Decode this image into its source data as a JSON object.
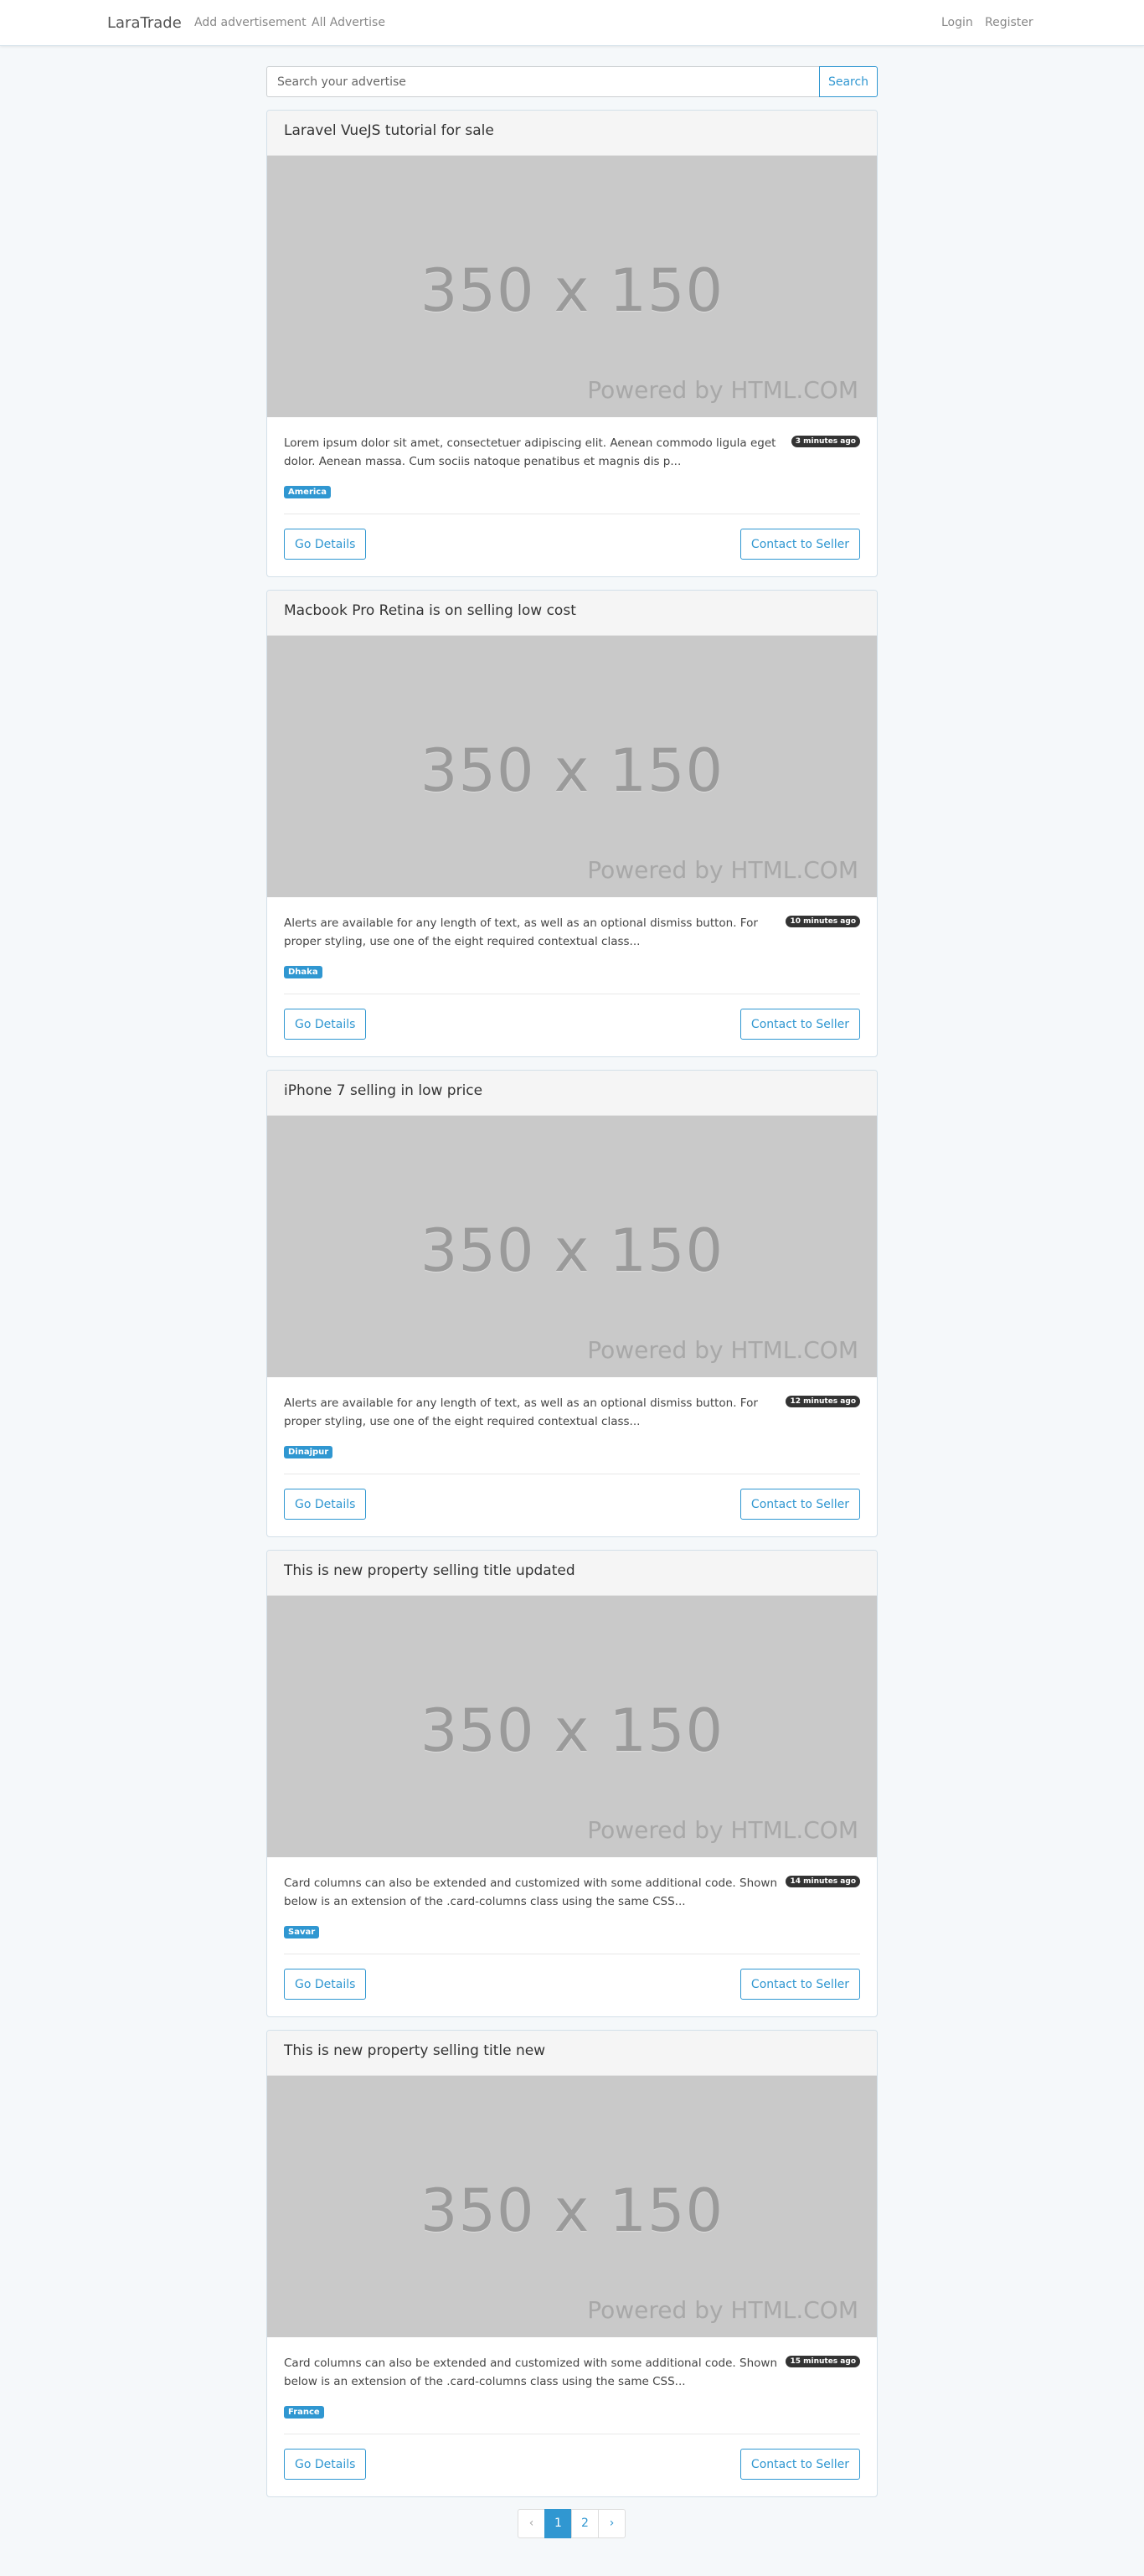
{
  "navbar": {
    "brand": "LaraTrade",
    "links": [
      "Add advertisement",
      "All Advertise"
    ],
    "auth": [
      "Login",
      "Register"
    ]
  },
  "search": {
    "placeholder": "Search your advertise",
    "button": "Search"
  },
  "placeholder_image": {
    "main_text": "350 x 150",
    "powered_text": "Powered by HTML.COM"
  },
  "ads": [
    {
      "title": "Laravel VueJS tutorial for sale",
      "excerpt": "Lorem ipsum dolor sit amet, consectetuer adipiscing elit. Aenean commodo ligula eget dolor. Aenean massa. Cum sociis natoque penatibus et magnis dis p...",
      "time": "3 minutes ago",
      "location": "America",
      "details_label": "Go Details",
      "contact_label": "Contact to Seller"
    },
    {
      "title": "Macbook Pro Retina is on selling low cost",
      "excerpt": "Alerts are available for any length of text, as well as an optional dismiss button. For proper styling, use one of the eight required contextual class...",
      "time": "10 minutes ago",
      "location": "Dhaka",
      "details_label": "Go Details",
      "contact_label": "Contact to Seller"
    },
    {
      "title": "iPhone 7 selling in low price",
      "excerpt": "Alerts are available for any length of text, as well as an optional dismiss button. For proper styling, use one of the eight required contextual class...",
      "time": "12 minutes ago",
      "location": "Dinajpur",
      "details_label": "Go Details",
      "contact_label": "Contact to Seller"
    },
    {
      "title": "This is new property selling title updated",
      "excerpt": "Card columns can also be extended and customized with some additional code. Shown below is an extension of the .card-columns class using the same CSS...",
      "time": "14 minutes ago",
      "location": "Savar",
      "details_label": "Go Details",
      "contact_label": "Contact to Seller"
    },
    {
      "title": "This is new property selling title new",
      "excerpt": "Card columns can also be extended and customized with some additional code. Shown below is an extension of the .card-columns class using the same CSS...",
      "time": "15 minutes ago",
      "location": "France",
      "details_label": "Go Details",
      "contact_label": "Contact to Seller"
    }
  ],
  "pagination": {
    "prev": "‹",
    "pages": [
      "1",
      "2"
    ],
    "next": "›",
    "current": "1"
  },
  "colors": {
    "accent": "#3097d1",
    "background": "#f5f8fa",
    "time_badge": "#333333"
  }
}
